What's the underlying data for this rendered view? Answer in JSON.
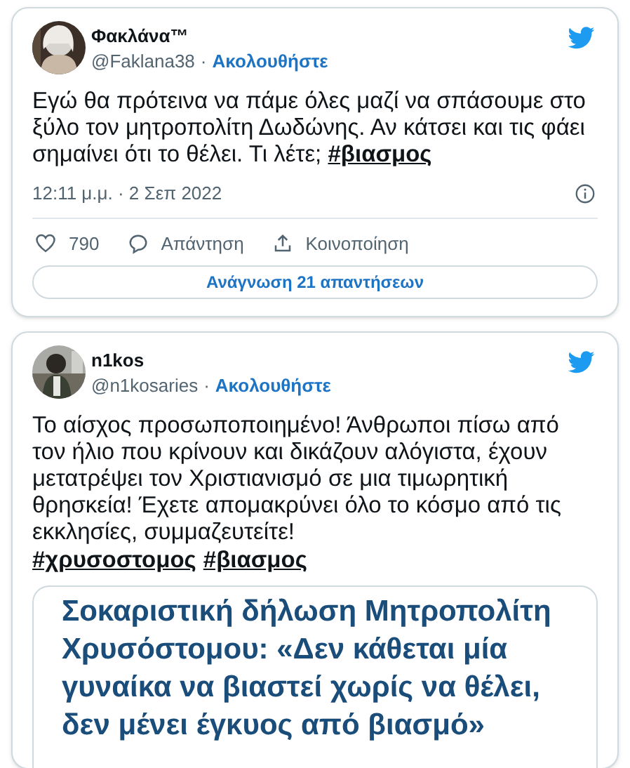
{
  "tweets": [
    {
      "author": {
        "name": "Φακλάνα™",
        "handle": "@Faklana38",
        "separator": "·",
        "follow": "Ακολουθήστε"
      },
      "text": "Εγώ θα πρότεινα να πάμε όλες μαζί  να σπάσουμε στο ξύλο τον μητροπολίτη Δωδώνης. Αν κάτσει και τις φάει σημαίνει ότι το θέλει. Τι λέτε; **#βιασμος**",
      "timestamp": "12:11 μ.μ. · 2 Σεπ 2022",
      "actions": [
        {
          "kind": "like",
          "label": "790"
        },
        {
          "kind": "reply",
          "label": "Απάντηση"
        },
        {
          "kind": "share",
          "label": "Κοινοποίηση"
        }
      ],
      "read_replies": "Ανάγνωση 21 απαντήσεων"
    },
    {
      "author": {
        "name": "n1kos",
        "handle": "@n1kosaries",
        "separator": "·",
        "follow": "Ακολουθήστε"
      },
      "text": "Το αίσχος προσωποποιημένο! Άνθρωποι πίσω από τον ήλιο που κρίνουν και δικάζουν αλόγιστα, έχουν μετατρέψει τον Χριστιανισμό σε μια τιμωρητική θρησκεία! Έχετε απομακρύνει όλο το κόσμο από τις εκκλησίες, συμμαζευτείτε!",
      "hashtags": [
        "#χρυσοστομος",
        "#βιασμος"
      ],
      "card": {
        "headline": "Σοκαριστική δήλωση Μητροπολίτη Χρυσόστομου: «Δεν κάθεται μία γυναίκα να βιαστεί χωρίς να θέλει, δεν μένει έγκυος από βιασμό»"
      }
    }
  ]
}
